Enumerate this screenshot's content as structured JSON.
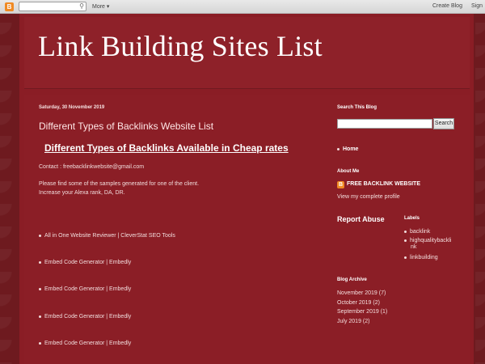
{
  "navbar": {
    "logo_letter": "B",
    "more_label": "More ▾",
    "create_blog_label": "Create Blog",
    "sign_in_label": "Sign"
  },
  "blog": {
    "title": "Link Building Sites List"
  },
  "post": {
    "date": "Saturday, 30 November 2019",
    "title": "Different Types of Backlinks Website List",
    "subtitle": "Different Types of Backlinks Available in Cheap rates",
    "contact": "Contact : freebacklinkwebsite@gmail.com",
    "paragraph_line1": "Please find some of the samples generated for one of the client.",
    "paragraph_line2": "Increase your Alexa rank, DA, DR.",
    "bullets": [
      "All in One Website Reviewer | CleverStat SEO Tools",
      "Embed Code Generator | Embedly",
      "Embed Code Generator | Embedly",
      "Embed Code Generator | Embedly",
      "Embed Code Generator | Embedly"
    ]
  },
  "sidebar": {
    "search_heading": "Search This Blog",
    "search_button": "Search",
    "home_link": "Home",
    "about_heading": "About Me",
    "profile_name": "FREE BACKLINK WEBSITE",
    "profile_link": "View my complete profile",
    "report_abuse": "Report Abuse",
    "labels_heading": "Labels",
    "labels": [
      "backlink",
      "highqualitybackli",
      "nk",
      "linkbuilding"
    ],
    "archive_heading": "Blog Archive",
    "archive": [
      "November 2019 (7)",
      "October 2019 (2)",
      "September 2019 (1)",
      "July 2019 (2)"
    ]
  }
}
